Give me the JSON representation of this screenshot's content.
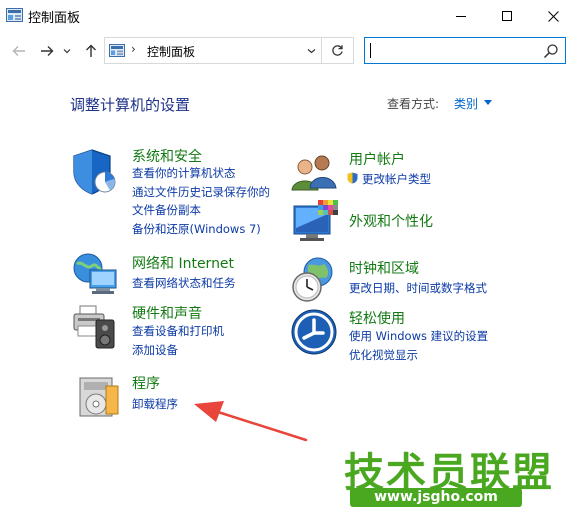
{
  "window": {
    "title": "控制面板"
  },
  "address": {
    "path_label": "控制面板",
    "separator": "›",
    "search_placeholder": ""
  },
  "content": {
    "heading": "调整计算机的设置",
    "view_by_label": "查看方式:",
    "view_by_value": "类别"
  },
  "categories": {
    "system": {
      "title": "系统和安全",
      "links": [
        "查看你的计算机状态",
        "通过文件历史记录保存你的",
        "文件备份副本",
        "备份和还原(Windows 7)"
      ]
    },
    "network": {
      "title": "网络和 Internet",
      "links": [
        "查看网络状态和任务"
      ]
    },
    "hardware": {
      "title": "硬件和声音",
      "links": [
        "查看设备和打印机",
        "添加设备"
      ]
    },
    "programs": {
      "title": "程序",
      "links": [
        "卸载程序"
      ]
    },
    "users": {
      "title": "用户帐户",
      "links": [
        "更改帐户类型"
      ]
    },
    "appearance": {
      "title": "外观和个性化",
      "links": []
    },
    "clock": {
      "title": "时钟和区域",
      "links": [
        "更改日期、时间或数字格式"
      ]
    },
    "ease": {
      "title": "轻松使用",
      "links": [
        "使用 Windows 建议的设置",
        "优化视觉显示"
      ]
    }
  },
  "watermark": {
    "text": "技术员联盟",
    "url": "www.jsgho.com"
  },
  "colors": {
    "category_title": "#137a13",
    "link": "#0b3aa6",
    "heading": "#1e3287",
    "accent": "#0078d7",
    "annotation_arrow": "#e8453c",
    "watermark": "#4aa820"
  },
  "icons": {
    "app": "control-panel-icon",
    "back": "arrow-left-icon",
    "forward": "arrow-right-icon",
    "recent": "chevron-down-icon",
    "up": "arrow-up-icon",
    "refresh": "refresh-icon",
    "search": "search-icon"
  }
}
